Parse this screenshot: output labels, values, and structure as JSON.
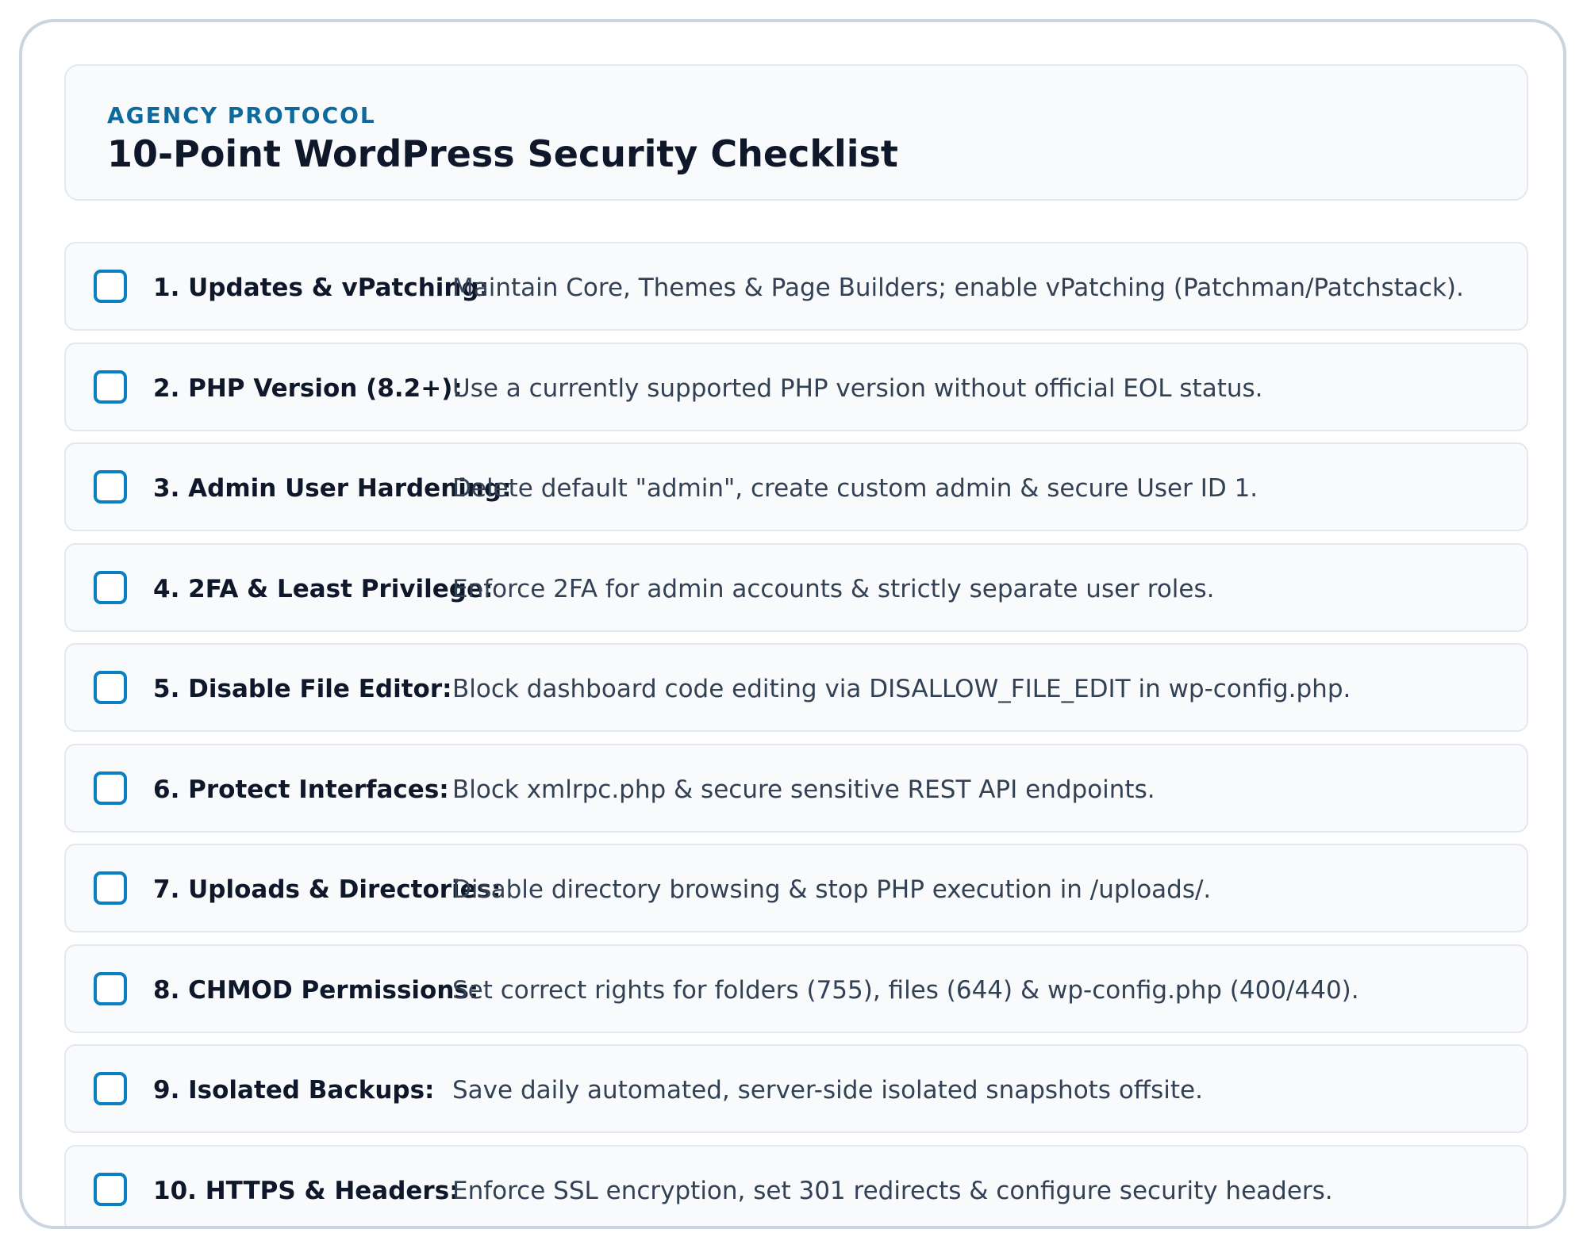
{
  "header": {
    "eyebrow": "AGENCY PROTOCOL",
    "title": "10-Point WordPress Security Checklist"
  },
  "checklist": [
    {
      "label": "1. Updates & vPatching:",
      "description": "Maintain Core, Themes & Page Builders; enable vPatching (Patchman/Patchstack).",
      "checked": false
    },
    {
      "label": "2. PHP Version (8.2+):",
      "description": "Use a currently supported PHP version without official EOL status.",
      "checked": false
    },
    {
      "label": "3. Admin User Hardening:",
      "description": "Delete default \"admin\", create custom admin & secure User ID 1.",
      "checked": false
    },
    {
      "label": "4. 2FA & Least Privilege:",
      "description": "Enforce 2FA for admin accounts & strictly separate user roles.",
      "checked": false
    },
    {
      "label": "5. Disable File Editor:",
      "description": "Block dashboard code editing via DISALLOW_FILE_EDIT in wp-config.php.",
      "checked": false
    },
    {
      "label": "6. Protect Interfaces:",
      "description": "Block xmlrpc.php & secure sensitive REST API endpoints.",
      "checked": false
    },
    {
      "label": "7. Uploads & Directories:",
      "description": "Disable directory browsing & stop PHP execution in /uploads/.",
      "checked": false
    },
    {
      "label": "8. CHMOD Permissions:",
      "description": "Set correct rights for folders (755), files (644) & wp-config.php (400/440).",
      "checked": false
    },
    {
      "label": "9. Isolated Backups:",
      "description": "Save daily automated, server-side isolated snapshots offsite.",
      "checked": false
    },
    {
      "label": "10. HTTPS & Headers:",
      "description": "Enforce SSL encryption, set 301 redirects & configure security headers.",
      "checked": false
    }
  ],
  "colors": {
    "accent": "#0a7fc2",
    "eyebrow": "#0e6a9c",
    "title": "#0f172a",
    "body_text": "#334155",
    "panel_bg": "#f8fafc",
    "panel_border": "#e2e8f0",
    "card_border": "#cbd5e1"
  }
}
